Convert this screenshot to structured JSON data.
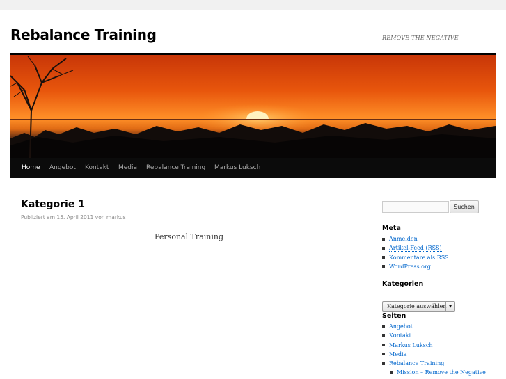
{
  "site": {
    "title": "Rebalance Training",
    "description": "REMOVE THE NEGATIVE"
  },
  "colors": {
    "link": "#0066cc",
    "nav_bg": "#0b0b0b",
    "sky_top": "#d83e08",
    "sky_horizon": "#ff9a28",
    "page_bg": "#f1f1f1"
  },
  "nav": {
    "items": [
      {
        "label": "Home",
        "active": true
      },
      {
        "label": "Angebot"
      },
      {
        "label": "Kontakt"
      },
      {
        "label": "Media"
      },
      {
        "label": "Rebalance Training"
      },
      {
        "label": "Markus Luksch"
      }
    ]
  },
  "post": {
    "title": "Kategorie 1",
    "meta_prefix": "Publiziert am",
    "date": "15. April 2011",
    "meta_by": "von",
    "author": "markus",
    "content": "Personal Training"
  },
  "sidebar": {
    "search": {
      "placeholder": "",
      "button_label": "Suchen"
    },
    "meta": {
      "title": "Meta",
      "items": [
        "Anmelden",
        "Artikel-Feed (RSS)",
        "Kommentare als RSS",
        "WordPress.org"
      ]
    },
    "categories": {
      "title": "Kategorien",
      "select_label": "Kategorie auswählen",
      "arrow_icon": "triangle-down-icon"
    },
    "pages": {
      "title": "Seiten",
      "items": [
        "Angebot",
        "Kontakt",
        "Markus Luksch",
        "Media",
        "Rebalance Training"
      ],
      "sub_items": [
        "Mission – Remove the Negative"
      ]
    }
  }
}
